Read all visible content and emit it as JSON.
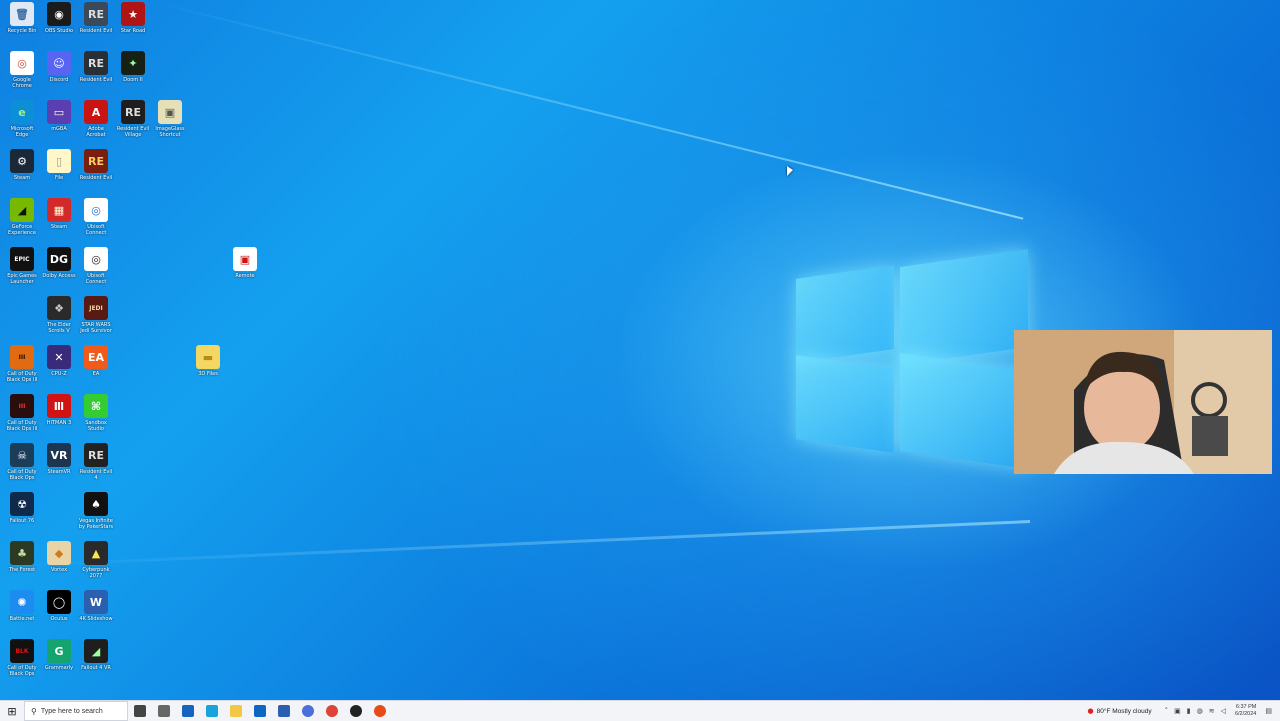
{
  "desktop": {
    "icons": [
      {
        "label": "Recycle Bin",
        "glyph": "🗑",
        "bg": "#dfe8f3",
        "fg": "#3a6ea5"
      },
      {
        "label": "OBS Studio",
        "glyph": "◉",
        "bg": "#1b1b1b",
        "fg": "#fff"
      },
      {
        "label": "Resident Evil",
        "glyph": "RE",
        "bg": "#3b4a5a",
        "fg": "#ddd"
      },
      {
        "label": "Star Road",
        "glyph": "★",
        "bg": "#b01515",
        "fg": "#fff"
      },
      {
        "label": "Google Chrome",
        "glyph": "◎",
        "bg": "#ffffff",
        "fg": "#db4437"
      },
      {
        "label": "Discord",
        "glyph": "☺",
        "bg": "#5865f2",
        "fg": "#fff"
      },
      {
        "label": "Resident Evil",
        "glyph": "RE",
        "bg": "#2a2f36",
        "fg": "#ddd"
      },
      {
        "label": "Doom II",
        "glyph": "✦",
        "bg": "#162014",
        "fg": "#9f9"
      },
      {
        "label": "Microsoft Edge",
        "glyph": "e",
        "bg": "#0c8fd6",
        "fg": "#9ef08a"
      },
      {
        "label": "mGBA",
        "glyph": "▭",
        "bg": "#5b3fb0",
        "fg": "#fff"
      },
      {
        "label": "Adobe Acrobat",
        "glyph": "A",
        "bg": "#c91414",
        "fg": "#fff"
      },
      {
        "label": "Resident Evil Village",
        "glyph": "RE",
        "bg": "#1e1e1e",
        "fg": "#ddd"
      },
      {
        "label": "ImageGlass Shortcut",
        "glyph": "▣",
        "bg": "#e6e0b8",
        "fg": "#555"
      },
      {
        "label": "Steam",
        "glyph": "⚙",
        "bg": "#1b2838",
        "fg": "#fff"
      },
      {
        "label": "File",
        "glyph": "▯",
        "bg": "#fff7c8",
        "fg": "#999"
      },
      {
        "label": "Resident Evil",
        "glyph": "RE",
        "bg": "#7a1f10",
        "fg": "#ffcc66"
      },
      {
        "label": "GeForce Experience",
        "glyph": "◢",
        "bg": "#76b900",
        "fg": "#111"
      },
      {
        "label": "Steam",
        "glyph": "▦",
        "bg": "#d22a2a",
        "fg": "#ffd"
      },
      {
        "label": "Ubisoft Connect",
        "glyph": "◎",
        "bg": "#ffffff",
        "fg": "#1a6fd8"
      },
      {
        "label": "Epic Games Launcher",
        "glyph": "EPIC",
        "bg": "#111",
        "fg": "#fff"
      },
      {
        "label": "Dolby Access",
        "glyph": "DG",
        "bg": "#111",
        "fg": "#fff"
      },
      {
        "label": "Ubisoft Connect",
        "glyph": "◎",
        "bg": "#ffffff",
        "fg": "#222"
      },
      {
        "label": "The Elder Scrolls V",
        "glyph": "❖",
        "bg": "#2a2a2a",
        "fg": "#ccc"
      },
      {
        "label": "STAR WARS Jedi Survivor",
        "glyph": "JEDI",
        "bg": "#5a1a14",
        "fg": "#f4d3a0"
      },
      {
        "label": "Call of Duty Black Ops III",
        "glyph": "III",
        "bg": "#e26a10",
        "fg": "#111"
      },
      {
        "label": "CPU-Z",
        "glyph": "✕",
        "bg": "#3a2a7a",
        "fg": "#fff"
      },
      {
        "label": "EA",
        "glyph": "EA",
        "bg": "#f05a1a",
        "fg": "#fff"
      },
      {
        "label": "Call of Duty Black Ops III",
        "glyph": "III",
        "bg": "#2a0d0d",
        "fg": "#e33"
      },
      {
        "label": "HITMAN 3",
        "glyph": "Ⅲ",
        "bg": "#d11313",
        "fg": "#fff"
      },
      {
        "label": "Sandbox Studio",
        "glyph": "⌘",
        "bg": "#33cc33",
        "fg": "#fff"
      },
      {
        "label": "Call of Duty Black Ops",
        "glyph": "☠",
        "bg": "#1a3d5a",
        "fg": "#fff"
      },
      {
        "label": "SteamVR",
        "glyph": "VR",
        "bg": "#1d3550",
        "fg": "#fff"
      },
      {
        "label": "Resident Evil 4",
        "glyph": "RE",
        "bg": "#222",
        "fg": "#ddd"
      },
      {
        "label": "Fallout 76",
        "glyph": "☢",
        "bg": "#0f2a4a",
        "fg": "#fff"
      },
      {
        "label": "Vegas Infinite by PokerStars",
        "glyph": "♠",
        "bg": "#111",
        "fg": "#fff"
      },
      {
        "label": "The Forest",
        "glyph": "♣",
        "bg": "#2b3a23",
        "fg": "#c8d9a0"
      },
      {
        "label": "Vortex",
        "glyph": "◆",
        "bg": "#e9d4a8",
        "fg": "#d07a1a"
      },
      {
        "label": "Cyberpunk 2077",
        "glyph": "▲",
        "bg": "#2a2a2a",
        "fg": "#ffe44a"
      },
      {
        "label": "Battle.net",
        "glyph": "✺",
        "bg": "#1d8cf0",
        "fg": "#fff"
      },
      {
        "label": "Oculus",
        "glyph": "◯",
        "bg": "#000",
        "fg": "#fff"
      },
      {
        "label": "4K Slideshow",
        "glyph": "W",
        "bg": "#2b5fb0",
        "fg": "#fff"
      },
      {
        "label": "Call of Duty Black Ops",
        "glyph": "BLK",
        "bg": "#111",
        "fg": "#e11"
      },
      {
        "label": "Grammarly",
        "glyph": "G",
        "bg": "#15a36f",
        "fg": "#fff"
      },
      {
        "label": "Fallout 4 VR",
        "glyph": "◢",
        "bg": "#1e1e1e",
        "fg": "#9f9"
      },
      {
        "label": "Remote",
        "glyph": "▣",
        "bg": "#ffffff",
        "fg": "#c11"
      },
      {
        "label": "3D Files",
        "glyph": "▬",
        "bg": "#f4d663",
        "fg": "#b88a12"
      }
    ]
  },
  "webcam": {
    "label": "webcam overlay"
  },
  "taskbar": {
    "start_glyph": "⊞",
    "search_placeholder": "Type here to search",
    "apps": [
      {
        "name": "cortana",
        "bg": "#444"
      },
      {
        "name": "task-view",
        "bg": "#666"
      },
      {
        "name": "mail",
        "bg": "#1565c0"
      },
      {
        "name": "edge",
        "bg": "#1aa3d8"
      },
      {
        "name": "file-explorer",
        "bg": "#f2c744"
      },
      {
        "name": "store",
        "bg": "#0b67c2"
      },
      {
        "name": "word",
        "bg": "#2b5fb0"
      },
      {
        "name": "chrome-profile",
        "bg": "#4c6fd8"
      },
      {
        "name": "chrome",
        "bg": "#db4437"
      },
      {
        "name": "obs",
        "bg": "#222"
      },
      {
        "name": "acrobat",
        "bg": "#e84a1a"
      }
    ],
    "weather": "80°F  Mostly cloudy",
    "time": "6:37 PM",
    "date": "6/2/2024"
  }
}
